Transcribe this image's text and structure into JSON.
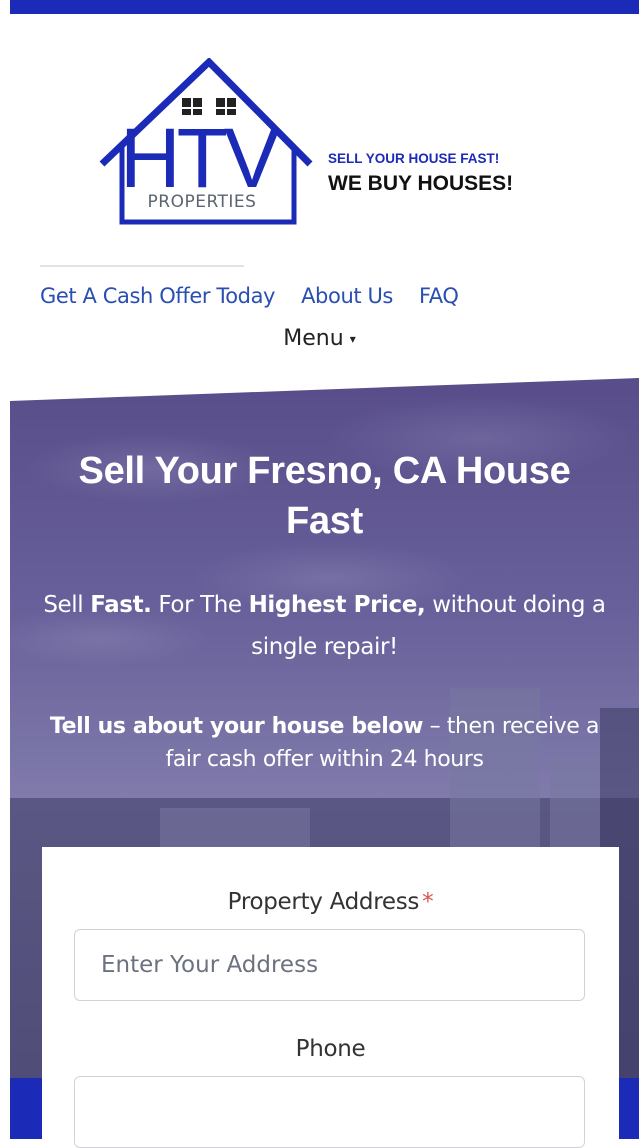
{
  "brand": {
    "logo_word": "HTV",
    "logo_sub": "PROPERTIES",
    "tagline_1": "SELL YOUR HOUSE FAST!",
    "tagline_2": "WE BUY HOUSES!",
    "color": "#1b2bb8"
  },
  "nav": {
    "items": [
      "Get A Cash Offer Today",
      "About Us",
      "FAQ"
    ],
    "menu_label": "Menu",
    "menu_caret": "▾"
  },
  "hero": {
    "title": "Sell Your Fresno, CA House Fast",
    "sub_1": "Sell ",
    "sub_fast": "Fast.",
    "sub_2": " For The ",
    "sub_highest": "Highest Price,",
    "sub_3": " without doing a single repair!",
    "tell_bold": "Tell us about your house below",
    "tell_rest": " – then receive a fair cash offer within 24 hours"
  },
  "form": {
    "address_label": "Property Address",
    "address_required": "*",
    "address_placeholder": "Enter Your Address",
    "phone_label": "Phone",
    "phone_value": ""
  }
}
